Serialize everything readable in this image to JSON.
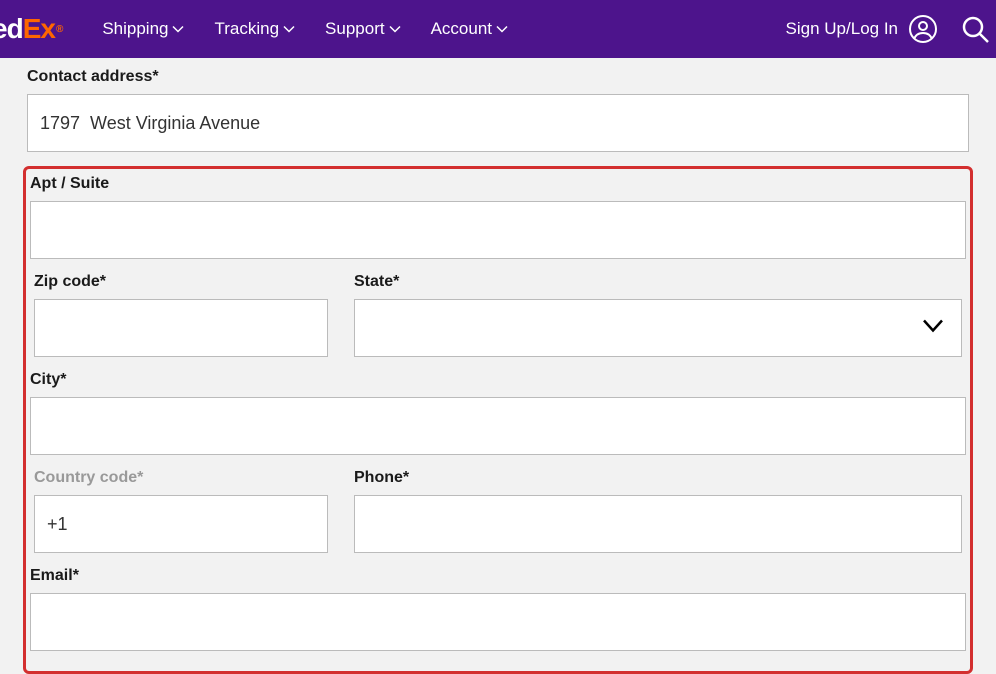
{
  "logo": {
    "fed": "ed",
    "ex": "Ex"
  },
  "nav": {
    "shipping": "Shipping",
    "tracking": "Tracking",
    "support": "Support",
    "account": "Account"
  },
  "auth": {
    "signup_login": "Sign Up/Log In"
  },
  "form": {
    "contact_address_label": "Contact address*",
    "contact_address_value": "1797  West Virginia Avenue",
    "apt_suite_label": "Apt / Suite",
    "apt_suite_value": "",
    "zip_label": "Zip code*",
    "zip_value": "",
    "state_label": "State*",
    "state_value": "",
    "city_label": "City*",
    "city_value": "",
    "country_code_label": "Country code*",
    "country_code_value": "+1",
    "phone_label": "Phone*",
    "phone_value": "",
    "email_label": "Email*",
    "email_value": ""
  }
}
